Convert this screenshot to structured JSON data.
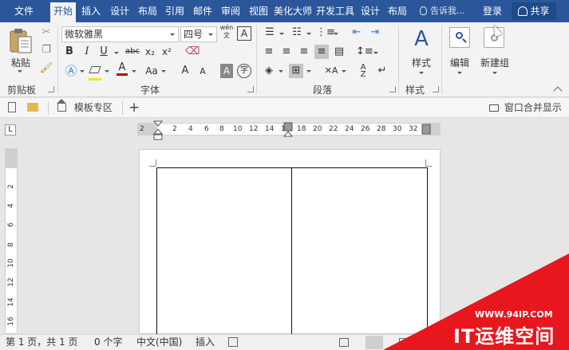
{
  "tabs": {
    "file": "文件",
    "items": [
      {
        "label": "开始",
        "active": true
      },
      {
        "label": "插入"
      },
      {
        "label": "设计"
      },
      {
        "label": "布局"
      },
      {
        "label": "引用"
      },
      {
        "label": "邮件"
      },
      {
        "label": "审阅"
      },
      {
        "label": "视图"
      },
      {
        "label": "美化大师"
      },
      {
        "label": "开发工具"
      },
      {
        "label": "设计"
      },
      {
        "label": "布局"
      }
    ],
    "tell_me": "告诉我...",
    "login": "登录",
    "share": "共享"
  },
  "ribbon": {
    "clipboard": {
      "paste": "粘贴",
      "group_label": "剪贴板"
    },
    "font": {
      "name": "微软雅黑",
      "size": "四号",
      "pinyin": "wén",
      "bold": "B",
      "italic": "I",
      "underline": "U",
      "strike": "abc",
      "sub": "x₂",
      "sup": "x²",
      "change_case": "Aa",
      "grow": "A",
      "shrink": "A",
      "char_shade": "A",
      "group_label": "字体"
    },
    "paragraph": {
      "group_label": "段落"
    },
    "styles": {
      "label": "样式",
      "group_label": "样式"
    },
    "editing": {
      "label": "编辑"
    },
    "newgroup": {
      "label": "新建组"
    }
  },
  "quickbar": {
    "template_zone": "模板专区",
    "add": "+",
    "merge_windows": "窗口合并显示"
  },
  "ruler": {
    "tab_selector": "L",
    "h_ticks": [
      "2",
      "2",
      "4",
      "6",
      "8",
      "10",
      "12",
      "14",
      "16",
      "18",
      "20",
      "22",
      "24",
      "26",
      "28",
      "30",
      "32"
    ],
    "v_ticks": [
      "2",
      "4",
      "6",
      "8",
      "10",
      "12",
      "14",
      "16"
    ]
  },
  "status": {
    "page": "第 1 页，共 1 页",
    "words": "0 个字",
    "language": "中文(中国)",
    "mode": "插入"
  },
  "watermark": {
    "url": "WWW.94IP.COM",
    "text": "IT运维空间"
  },
  "colors": {
    "accent": "#2b579a",
    "ribbon_bg": "#f3f3f3",
    "watermark_red": "#e8161d"
  }
}
